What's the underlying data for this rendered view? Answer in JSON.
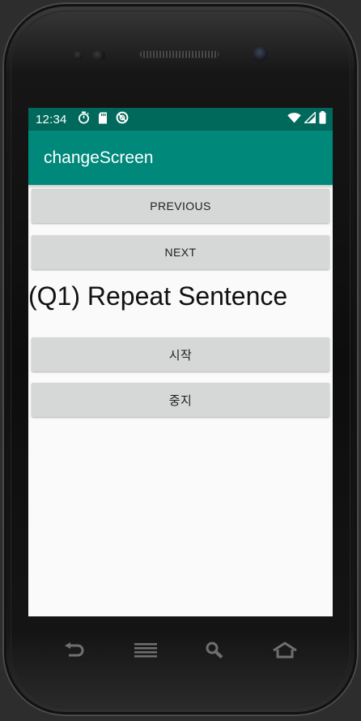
{
  "status_bar": {
    "time": "12:34",
    "icons": [
      "stopwatch-icon",
      "sd-card-icon",
      "sync-off-icon",
      "wifi-icon",
      "signal-icon",
      "battery-icon"
    ]
  },
  "app_bar": {
    "title": "changeScreen"
  },
  "buttons": {
    "previous": "PREVIOUS",
    "next": "NEXT",
    "start": "시작",
    "stop": "중지"
  },
  "question": {
    "text": "(Q1) Repeat Sentence"
  },
  "nav_bar": {
    "icons": [
      "back-icon",
      "menu-icon",
      "search-icon",
      "home-icon"
    ]
  },
  "colors": {
    "status_bar": "#00695c",
    "app_bar": "#00897b",
    "button_bg": "#d6d7d7",
    "screen_bg": "#fafafa"
  }
}
